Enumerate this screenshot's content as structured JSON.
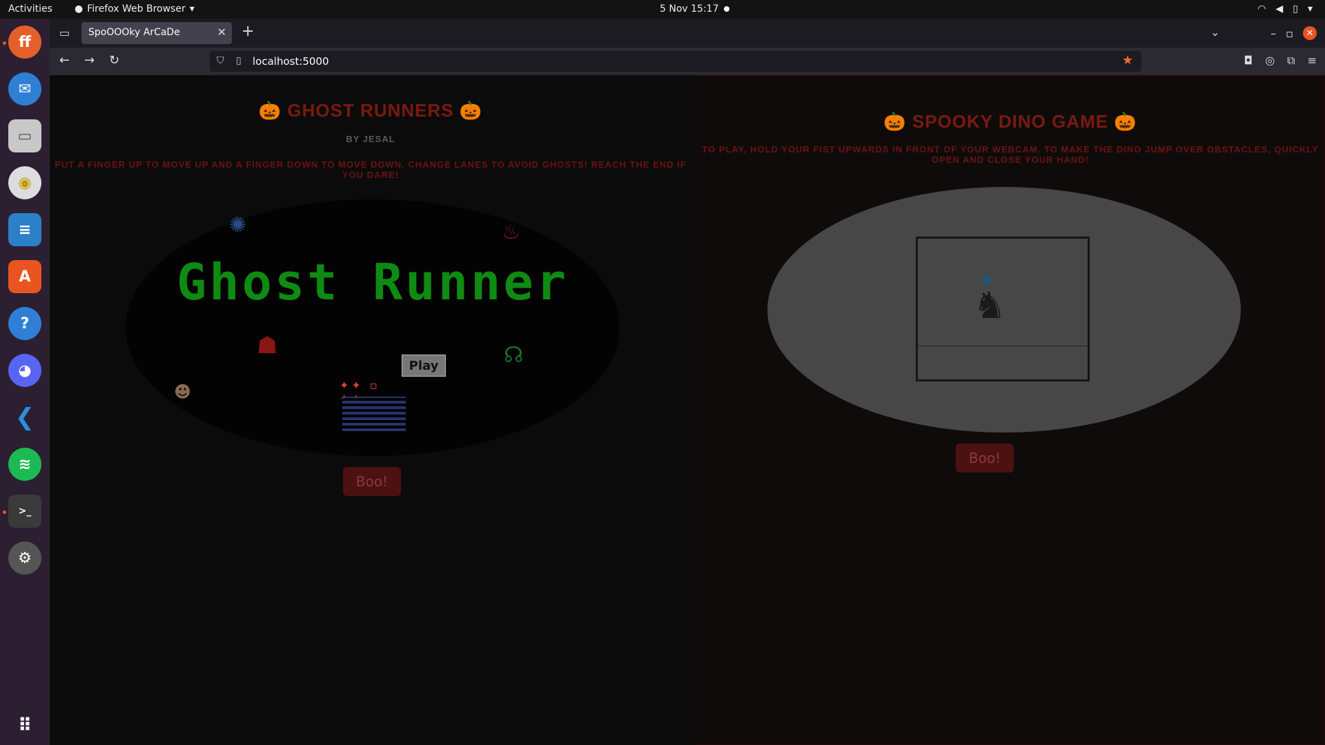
{
  "topbar": {
    "activities": "Activities",
    "app_menu": "Firefox Web Browser",
    "clock": "5 Nov  15:17"
  },
  "dock": {
    "icons": [
      "firefox-icon",
      "thunderbird-icon",
      "files-icon",
      "rhythmbox-icon",
      "writer-icon",
      "app-center-icon",
      "help-icon",
      "discord-icon",
      "vscode-icon",
      "spotify-icon",
      "terminal-icon",
      "settings-icon",
      "app-grid-icon"
    ]
  },
  "browser": {
    "tab_title": "SpoOOOky ArCaDe",
    "url": "localhost:5000"
  },
  "ghost_runner": {
    "title": "🎃 GHOST RUNNERS 🎃",
    "author": "BY JESAL",
    "instructions": "PUT A FINGER UP TO MOVE UP AND A FINGER DOWN TO MOVE DOWN. CHANGE LANES TO AVOID GHOSTS! REACH THE END IF YOU DARE!",
    "logo": "Ghost Runner",
    "play_label": "Play",
    "boo_label": "Boo!"
  },
  "dino": {
    "title": "🎃 SPOOKY DINO GAME 🎃",
    "instructions": "TO PLAY, HOLD YOUR FIST UPWARDS IN FRONT OF YOUR WEBCAM. TO MAKE THE DINO JUMP OVER OBSTACLES, QUICKLY OPEN AND CLOSE YOUR HAND!",
    "boo_label": "Boo!"
  },
  "colors": {
    "accent_title": "#7a1a10",
    "logo_green": "#0f8a12",
    "boo_bg": "#4c1111"
  }
}
